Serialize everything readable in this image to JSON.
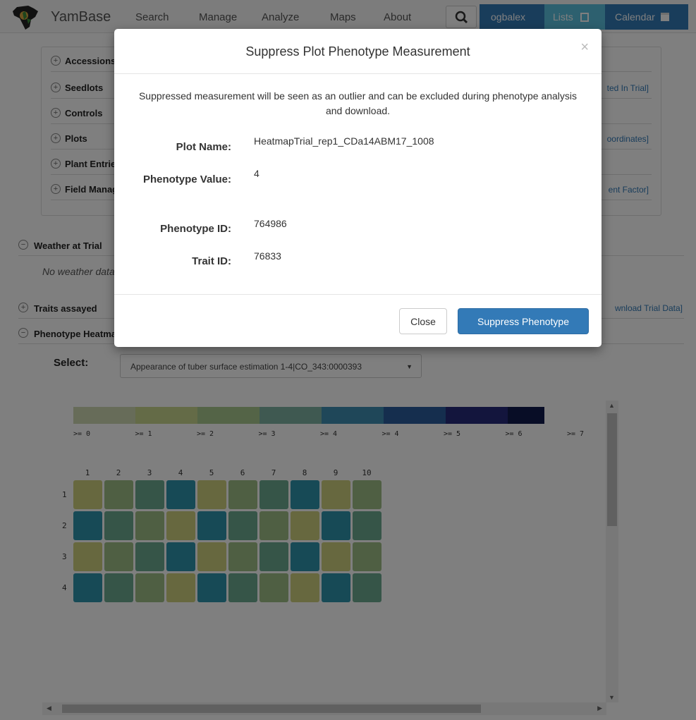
{
  "colors": {
    "legend": [
      "#cfd8b2",
      "#c9d68f",
      "#a9c98e",
      "#7fb3a2",
      "#3f8fb2",
      "#2a5c9d",
      "#262a7a",
      "#111b4d"
    ],
    "heatmap_palette": [
      "#cfd17e",
      "#9ebe86",
      "#6cab90",
      "#2e95ad"
    ]
  },
  "navbar": {
    "brand": "YamBase",
    "items": [
      "Search",
      "Manage",
      "Analyze",
      "Maps",
      "About"
    ],
    "user": "ogbalex",
    "lists": "Lists",
    "calendar": "Calendar"
  },
  "page": {
    "sections": [
      {
        "label": "Accessions",
        "right": ""
      },
      {
        "label": "Seedlots",
        "right": "ted In Trial]"
      },
      {
        "label": "Controls",
        "right": ""
      },
      {
        "label": "Plots",
        "right": "oordinates]"
      },
      {
        "label": "Plant Entries",
        "right": ""
      },
      {
        "label": "Field Management",
        "right": "ent Factor]"
      }
    ],
    "weather": {
      "label": "Weather at Trial",
      "empty_text": "No weather data"
    },
    "traits": {
      "label": "Traits assayed",
      "right": "wnload Trial Data]"
    },
    "heatmap_section": {
      "label": "Phenotype Heatmap"
    },
    "select_label": "Select:",
    "select_value": "Appearance of tuber surface estimation 1-4|CO_343:0000393"
  },
  "chart_data": {
    "type": "heatmap",
    "legend_labels": [
      ">= 0",
      ">= 1",
      ">= 2",
      ">= 3",
      ">= 4",
      ">= 4",
      ">= 5",
      ">= 6",
      ">= 7"
    ],
    "columns": [
      "1",
      "2",
      "3",
      "4",
      "5",
      "6",
      "7",
      "8",
      "9",
      "10"
    ],
    "rows": [
      "1",
      "2",
      "3",
      "4"
    ],
    "values": [
      [
        1,
        2,
        3,
        4,
        1,
        2,
        3,
        4,
        1,
        2
      ],
      [
        4,
        3,
        2,
        1,
        4,
        3,
        2,
        1,
        4,
        3
      ],
      [
        1,
        2,
        3,
        4,
        1,
        2,
        3,
        4,
        1,
        2
      ],
      [
        4,
        3,
        2,
        1,
        4,
        3,
        2,
        1,
        4,
        3
      ]
    ]
  },
  "modal": {
    "title": "Suppress Plot Phenotype Measurement",
    "close_symbol": "×",
    "message": "Suppressed measurement will be seen as an outlier and can be excluded during phenotype analysis and download.",
    "fields": [
      {
        "label": "Plot Name:",
        "value": "HeatmapTrial_rep1_CDa14ABM17_1008"
      },
      {
        "label": "Phenotype Value:",
        "value": "4"
      },
      {
        "label": "Phenotype ID:",
        "value": "764986"
      },
      {
        "label": "Trait ID:",
        "value": "76833"
      }
    ],
    "buttons": {
      "close": "Close",
      "suppress": "Suppress Phenotype"
    }
  }
}
